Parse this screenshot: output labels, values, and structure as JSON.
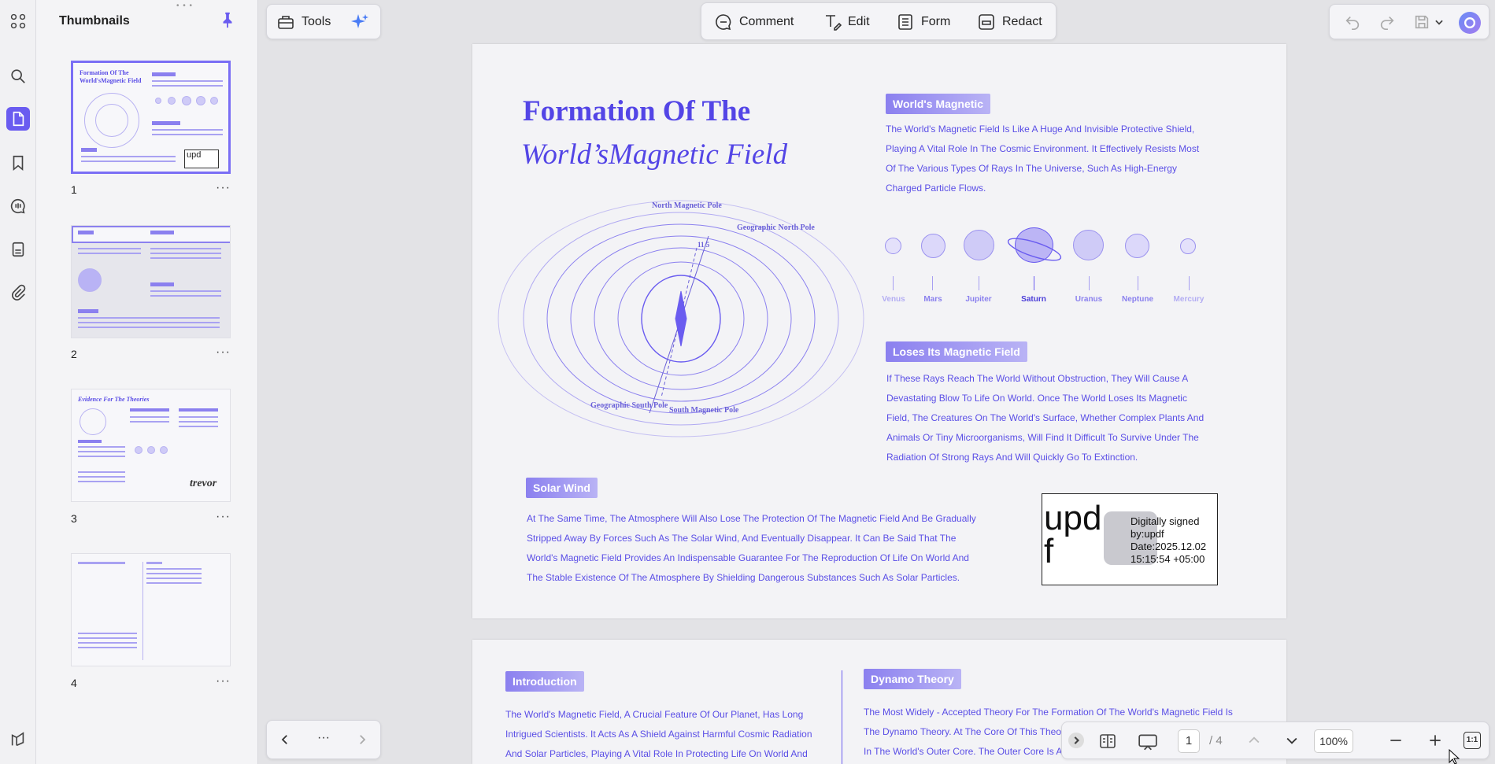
{
  "sidebar_panel": {
    "title": "Thumbnails"
  },
  "thumbnails": [
    {
      "page": "1",
      "more": "···",
      "title": "Formation Of The World'sMagnetic Field",
      "sig": "upd"
    },
    {
      "page": "2",
      "more": "···"
    },
    {
      "page": "3",
      "more": "···",
      "title": "Evidence For The Theories",
      "sig": "trevor"
    },
    {
      "page": "4",
      "more": "···"
    }
  ],
  "toolbar": {
    "tools_label": "Tools",
    "comment_label": "Comment",
    "edit_label": "Edit",
    "form_label": "Form",
    "redact_label": "Redact"
  },
  "doc": {
    "title_line1": "Formation Of The",
    "title_line2": "World’sMagnetic Field",
    "tag_worlds_magnetic": "World's Magnetic",
    "para_worlds_magnetic": [
      "The World's Magnetic Field Is Like A Huge And Invisible Protective Shield,",
      "Playing A Vital Role In The Cosmic Environment. It Effectively Resists Most",
      "Of The Various Types Of Rays In The Universe, Such As High-Energy",
      "Charged Particle Flows."
    ],
    "planets": [
      "Venus",
      "Mars",
      "Jupiter",
      "Saturn",
      "Uranus",
      "Neptune",
      "Mercury"
    ],
    "diagram_labels": {
      "north_magnetic": "North\nMagnetic Pole",
      "geo_north": "Geographic\nNorth Pole",
      "angle": "11.5",
      "geo_south": "Geographic\nSouth Pole",
      "south_magnetic": "South\nMagnetic\nPole"
    },
    "tag_loses": "Loses Its Magnetic Field",
    "para_loses": [
      "If These Rays Reach The World Without Obstruction, They Will Cause A",
      "Devastating Blow To Life On World. Once The World Loses Its Magnetic",
      "Field, The Creatures On The World's Surface, Whether Complex Plants And",
      "Animals Or Tiny Microorganisms, Will Find It Difficult To Survive Under The",
      "Radiation Of Strong Rays And Will Quickly Go To Extinction."
    ],
    "tag_solar": "Solar Wind",
    "para_solar": [
      "At The Same Time, The Atmosphere Will Also Lose The Protection Of The Magnetic Field And Be Gradually",
      "Stripped Away By Forces Such As The Solar Wind, And Eventually Disappear. It Can Be Said That The",
      "World's Magnetic Field Provides An Indispensable Guarantee For The Reproduction Of Life On World And",
      "The Stable Existence Of The Atmosphere By Shielding Dangerous Substances Such As Solar Particles."
    ],
    "signature": {
      "big": "upd\nf",
      "text": "Digitally signed\nby:updf\nDate:2025.12.02\n15:15:54 +05:00"
    },
    "tag_intro": "Introduction",
    "para_intro": [
      "The World's Magnetic Field, A Crucial Feature Of Our Planet, Has Long",
      "Intrigued Scientists. It Acts As A Shield Against Harmful Cosmic Radiation",
      "And Solar Particles, Playing A Vital Role In Protecting Life On World And"
    ],
    "tag_dynamo": "Dynamo Theory",
    "para_dynamo": [
      "The Most Widely - Accepted Theory For The Formation Of The World's Magnetic Field Is",
      "The Dynamo Theory. At The Core Of This Theory",
      "In The World's Outer Core. The Outer Core Is A"
    ]
  },
  "page_nav": {
    "current": "1",
    "total": "/ 4"
  },
  "zoom": {
    "level": "100%",
    "fit_label": "1:1"
  },
  "thumb_nav": {
    "more": "···"
  },
  "colors": {
    "accent": "#6a5cf0",
    "doc_text": "#5a4ee6",
    "doc_heading": "#5345e6"
  }
}
